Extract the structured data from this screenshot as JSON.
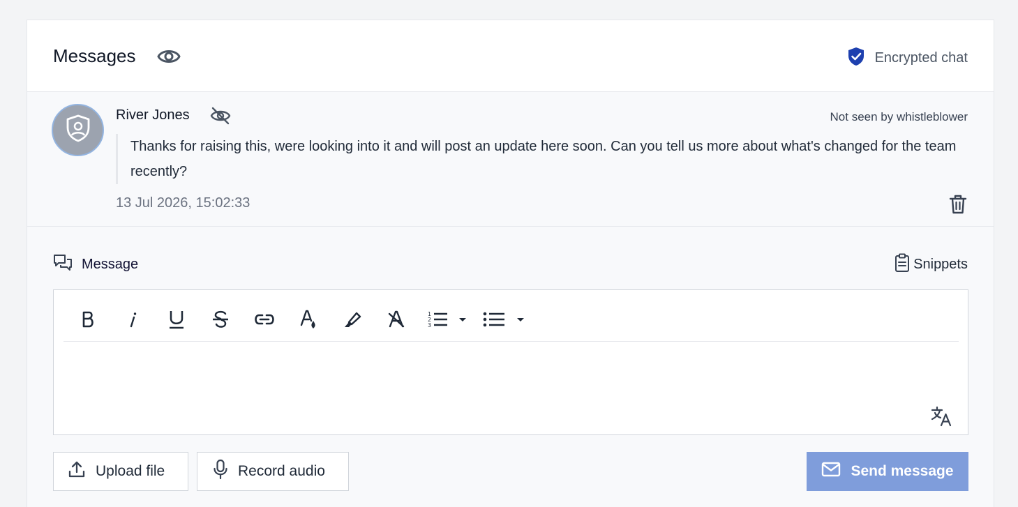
{
  "header": {
    "title": "Messages",
    "encrypted_label": "Encrypted chat",
    "icons": {
      "visibility": "eye-icon",
      "encryption": "shield-check-icon"
    }
  },
  "message": {
    "author": "River Jones",
    "seen_status": "Not seen by whistleblower",
    "body": "Thanks for raising this, were looking into it and will post an update here soon. Can you tell us more about what's changed for the team recently?",
    "timestamp": "13 Jul 2026, 15:02:33",
    "icons": {
      "avatar": "user-shield-icon",
      "hidden": "eye-slash-icon",
      "delete": "trash-icon"
    }
  },
  "composer": {
    "label": "Message",
    "snippets_label": "Snippets",
    "toolbar": [
      "bold",
      "italic",
      "underline",
      "strikethrough",
      "link",
      "text-color",
      "highlight",
      "clear-format",
      "ordered-list",
      "bullet-list"
    ],
    "actions": {
      "upload_label": "Upload file",
      "record_label": "Record audio",
      "send_label": "Send message"
    }
  },
  "colors": {
    "accent": "#1e40af",
    "send_button": "#7f9ddb",
    "page_bg": "#f3f4f6"
  }
}
